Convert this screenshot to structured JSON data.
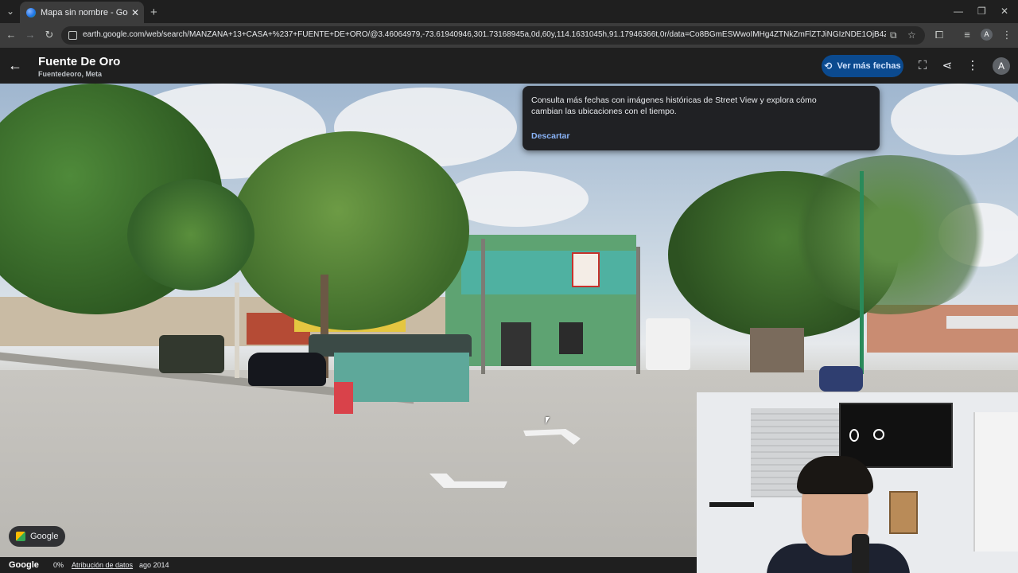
{
  "browser": {
    "tab_title": "Mapa sin nombre - Google Earth",
    "url": "earth.google.com/web/search/MANZANA+13+CASA+%237+FUENTE+DE+ORO/@3.46064979,-73.61940946,301.73168945a,0d,60y,114.1631045h,91.17946366t,0r/data=Co8BGmESWwoIMHg4ZTNkZmFlZTJiNGIzNDE1OjB4ZGU1NmRlMjYyYmEx...",
    "profile_initial": "A"
  },
  "earth": {
    "place_title": "Fuente De Oro",
    "place_subtitle": "Fuentedeoro, Meta",
    "more_dates_label": "Ver más fechas",
    "profile_initial": "A"
  },
  "tooltip": {
    "message": "Consulta más fechas con imágenes históricas de Street View y explora cómo cambian las ubicaciones con el tiempo.",
    "dismiss_label": "Descartar"
  },
  "chip": {
    "label": "Google"
  },
  "footer": {
    "logo": "Google",
    "percent": "0%",
    "attribution": "Atribución de datos",
    "date": "ago 2014"
  },
  "colors": {
    "accent": "#0b4a8f",
    "link": "#8ab4f8",
    "background": "#1f1f1f"
  }
}
